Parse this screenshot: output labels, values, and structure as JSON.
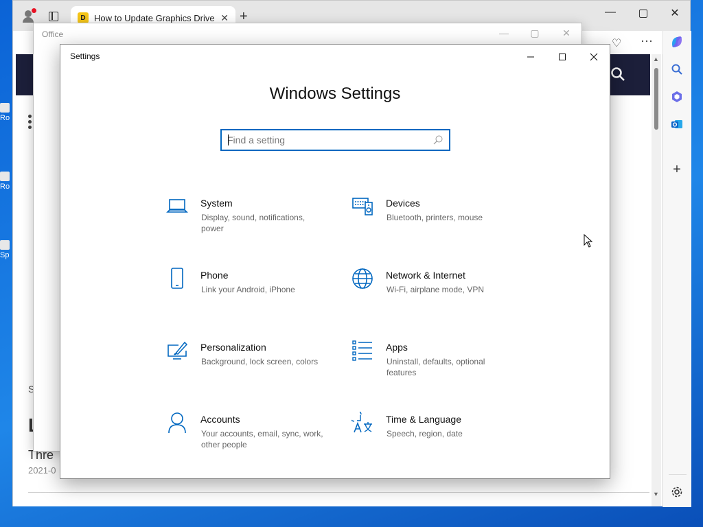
{
  "browser": {
    "tab_title": "How to Update Graphics Driver f",
    "tab_favicon_label": "D",
    "new_tab_glyph": "+",
    "close_glyph": "✕",
    "minimize_glyph": "—",
    "maximize_glyph": "▢",
    "window_close_glyph": "✕",
    "toolbar_more": "···",
    "page_text_s": "S",
    "page_text_l": "L",
    "page_text_thre": "Thre",
    "page_date": "2021-0"
  },
  "desktop": {
    "icon_labels": [
      "Ro",
      "Ro",
      "Sp"
    ]
  },
  "office": {
    "title": "Office"
  },
  "settings": {
    "window_title": "Settings",
    "heading": "Windows Settings",
    "search_placeholder": "Find a setting",
    "items": [
      {
        "label": "System",
        "desc": "Display, sound, notifications, power",
        "icon": "laptop-icon"
      },
      {
        "label": "Devices",
        "desc": "Bluetooth, printers, mouse",
        "icon": "devices-icon"
      },
      {
        "label": "Phone",
        "desc": "Link your Android, iPhone",
        "icon": "phone-icon"
      },
      {
        "label": "Network & Internet",
        "desc": "Wi-Fi, airplane mode, VPN",
        "icon": "globe-icon"
      },
      {
        "label": "Personalization",
        "desc": "Background, lock screen, colors",
        "icon": "paint-icon"
      },
      {
        "label": "Apps",
        "desc": "Uninstall, defaults, optional features",
        "icon": "apps-list-icon"
      },
      {
        "label": "Accounts",
        "desc": "Your accounts, email, sync, work, other people",
        "icon": "person-icon"
      },
      {
        "label": "Time & Language",
        "desc": "Speech, region, date",
        "icon": "time-language-icon"
      }
    ]
  },
  "colors": {
    "accent": "#0067c0",
    "banner": "#1c1f3a"
  }
}
